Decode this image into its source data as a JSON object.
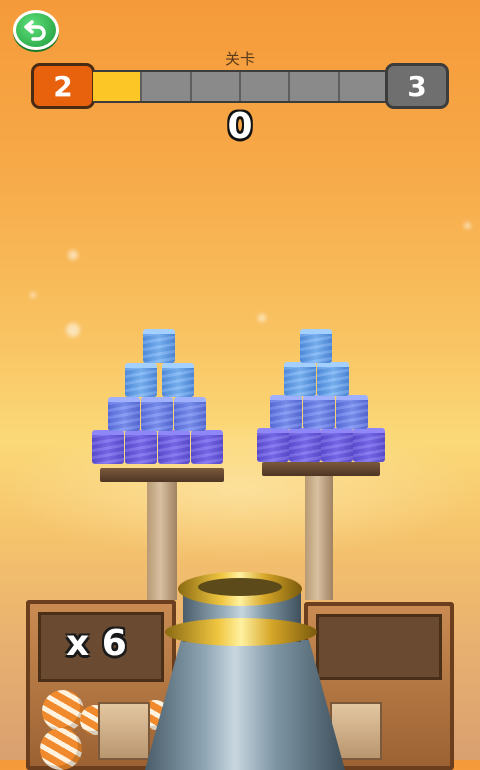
{
  "hud": {
    "back_icon": "undo-arrow-icon",
    "level_caption": "关卡",
    "current_level": "2",
    "next_level": "3",
    "progress_segments_total": 6,
    "progress_segments_filled": 1,
    "score": "0"
  },
  "launcher": {
    "ammo_count": "x 6"
  },
  "colors": {
    "level_current": "#e8620d",
    "level_next": "#6f6f6f",
    "progress_fill": "#fcc626",
    "back_button": "#1f9a3c",
    "can_blue": "#6b5ce6"
  }
}
